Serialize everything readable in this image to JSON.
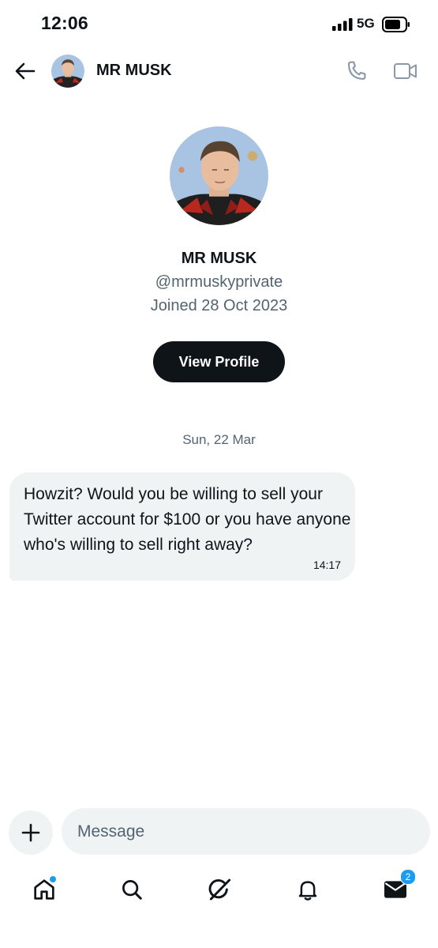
{
  "status_bar": {
    "time": "12:06",
    "network": "5G"
  },
  "header": {
    "contact_name": "MR MUSK"
  },
  "profile": {
    "name": "MR MUSK",
    "handle": "@mrmuskyprivate",
    "joined": "Joined 28 Oct 2023",
    "view_profile_label": "View Profile"
  },
  "conversation": {
    "date_divider": "Sun, 22 Mar",
    "messages": [
      {
        "text": "Howzit? Would you be willing to sell your Twitter account for $100  or you have anyone who's willing to sell right away?",
        "time": "14:17"
      }
    ]
  },
  "composer": {
    "placeholder": "Message"
  },
  "bottom_nav": {
    "items": [
      {
        "icon": "home-icon",
        "has_dot": true
      },
      {
        "icon": "search-icon"
      },
      {
        "icon": "grok-icon"
      },
      {
        "icon": "bell-icon"
      },
      {
        "icon": "mail-icon",
        "badge": "2"
      }
    ]
  },
  "colors": {
    "accent": "#1d9bf0",
    "text": "#0f1419",
    "muted": "#536471",
    "bubble": "#eff3f4"
  }
}
